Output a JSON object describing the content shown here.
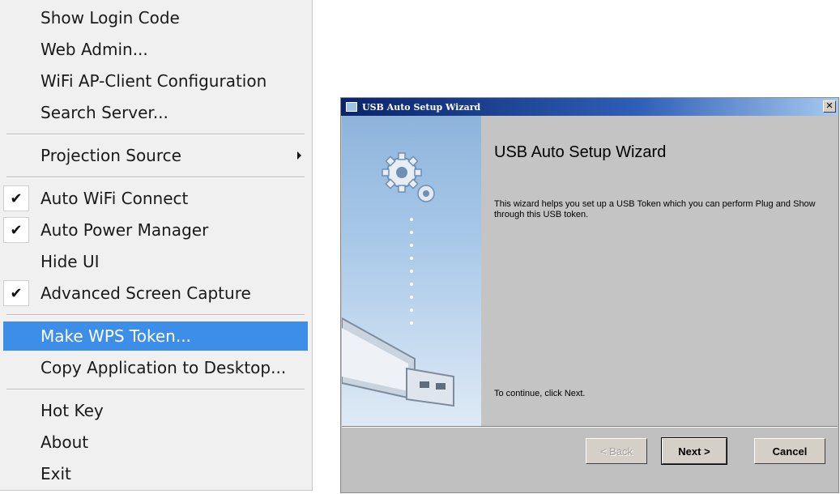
{
  "context_menu": {
    "items": [
      {
        "label": "Show Login Code"
      },
      {
        "label": "Web Admin..."
      },
      {
        "label": "WiFi AP-Client Configuration"
      },
      {
        "label": "Search Server..."
      },
      {
        "label": "Projection Source"
      },
      {
        "label": "Auto WiFi Connect",
        "checked": true
      },
      {
        "label": "Auto Power Manager",
        "checked": true
      },
      {
        "label": "Hide UI"
      },
      {
        "label": "Advanced Screen Capture",
        "checked": true
      },
      {
        "label": "Make WPS Token..."
      },
      {
        "label": "Copy Application to Desktop..."
      },
      {
        "label": "Hot Key"
      },
      {
        "label": "About"
      },
      {
        "label": "Exit"
      }
    ],
    "check_glyph": "✔",
    "highlight_color": "#3d8ee8"
  },
  "wizard": {
    "window_title": "USB Auto Setup Wizard",
    "close_glyph": "✕",
    "heading": "USB Auto Setup Wizard",
    "description": "This wizard helps you set up a USB Token which you can perform Plug and Show through this USB token.",
    "continue_text": "To continue, click Next.",
    "buttons": {
      "back": "< Back",
      "next": "Next >",
      "cancel": "Cancel"
    },
    "icons": {
      "side": "gear-icon",
      "device": "usb-drive-icon"
    },
    "titlebar_color": "#0a246a"
  }
}
